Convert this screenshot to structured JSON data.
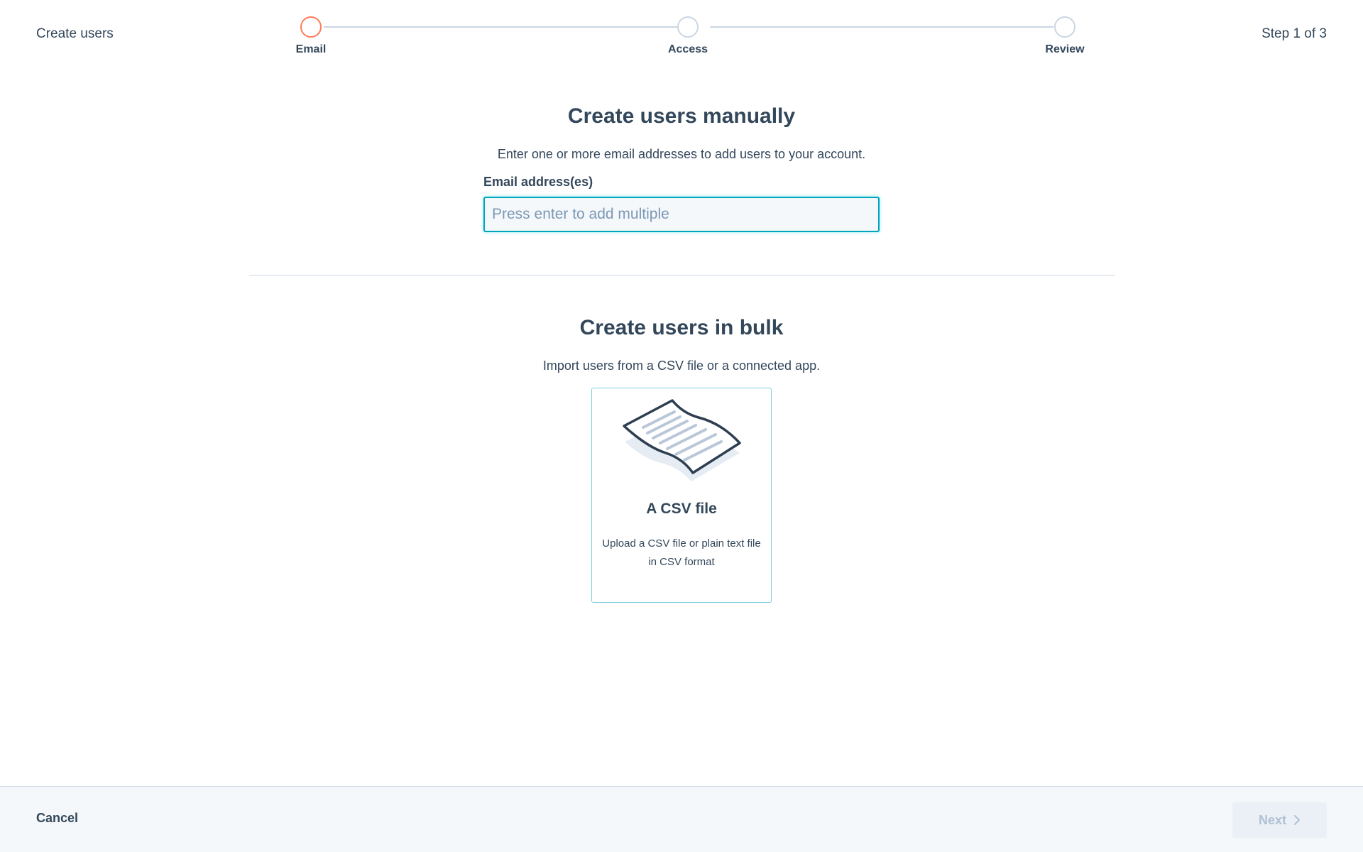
{
  "header": {
    "title": "Create users",
    "step_count": "Step 1 of 3"
  },
  "stepper": {
    "steps": [
      {
        "label": "Email",
        "state": "active"
      },
      {
        "label": "Access",
        "state": "upcoming"
      },
      {
        "label": "Review",
        "state": "upcoming"
      }
    ]
  },
  "manual": {
    "title": "Create users manually",
    "description": "Enter one or more email addresses to add users to your account.",
    "email_label": "Email address(es)",
    "email_placeholder": "Press enter to add multiple",
    "email_value": ""
  },
  "bulk": {
    "title": "Create users in bulk",
    "description": "Import users from a CSV file or a connected app.",
    "options": [
      {
        "title": "A CSV file",
        "description": "Upload a CSV file or plain text file in CSV format",
        "icon": "csv-file-icon"
      }
    ]
  },
  "footer": {
    "cancel_label": "Cancel",
    "next_label": "Next",
    "next_icon": "chevron-right-icon",
    "next_disabled": true
  },
  "colors": {
    "text": "#33475b",
    "active_step": "#ff7a59",
    "inactive_step": "#cbd6e2",
    "focus_border": "#00a4bd",
    "card_border": "#7fd1de",
    "footer_bg": "#f5f8fa",
    "disabled_button_bg": "#eaf0f6",
    "disabled_button_text": "#b0c1d4"
  }
}
